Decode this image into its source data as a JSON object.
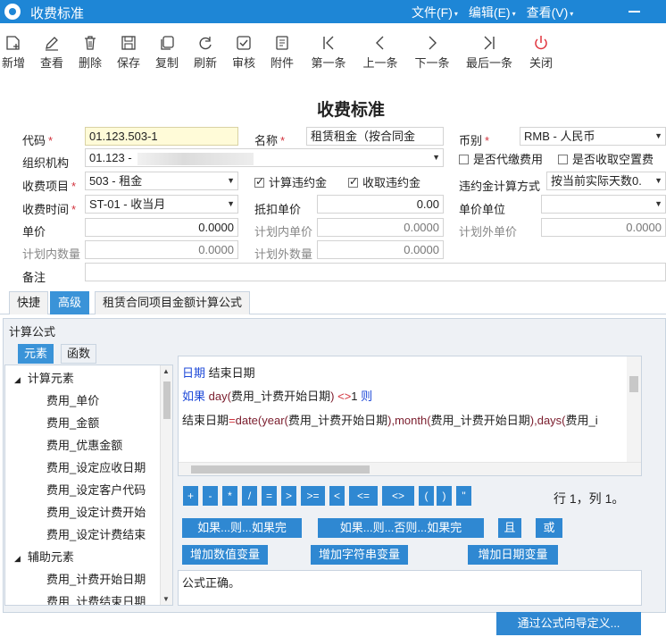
{
  "window": {
    "title": "收费标准",
    "menus": [
      "文件(F)",
      "编辑(E)",
      "查看(V)"
    ]
  },
  "toolbar": [
    {
      "label": "新增",
      "icon": "add-doc-icon"
    },
    {
      "label": "查看",
      "icon": "edit-pencil-icon"
    },
    {
      "label": "删除",
      "icon": "trash-icon"
    },
    {
      "label": "保存",
      "icon": "save-disk-icon"
    },
    {
      "label": "复制",
      "icon": "copy-icon"
    },
    {
      "label": "刷新",
      "icon": "refresh-icon"
    },
    {
      "label": "审核",
      "icon": "approve-check-icon"
    },
    {
      "label": "附件",
      "icon": "attachment-doc-icon"
    },
    {
      "label": "第一条",
      "icon": "first-record-icon"
    },
    {
      "label": "上一条",
      "icon": "prev-record-icon"
    },
    {
      "label": "下一条",
      "icon": "next-record-icon"
    },
    {
      "label": "最后一条",
      "icon": "last-record-icon"
    },
    {
      "label": "关闭",
      "icon": "power-close-icon"
    }
  ],
  "form": {
    "title": "收费标准",
    "code_label": "代码",
    "code_value": "01.123.503-1",
    "name_label": "名称",
    "name_value": "租赁租金（按合同金",
    "currency_label": "币别",
    "currency_value": "RMB - 人民币",
    "org_label": "组织机构",
    "org_value": "01.123 -",
    "substitute_label": "是否代缴费用",
    "vacant_label": "是否收取空置费",
    "fee_item_label": "收费项目",
    "fee_item_value": "503 - 租金",
    "calc_penalty_label": "计算违约金",
    "collect_penalty_label": "收取违约金",
    "penalty_method_label": "违约金计算方式",
    "penalty_method_value": "按当前实际天数0.",
    "fee_time_label": "收费时间",
    "fee_time_value": "ST-01 - 收当月",
    "deduct_price_label": "抵扣单价",
    "deduct_price_value": "0.00",
    "price_unit_label": "单价单位",
    "price_unit_value": "",
    "unit_price_label": "单价",
    "unit_price_value": "0.0000",
    "plan_in_price_label": "计划内单价",
    "plan_in_price_value": "0.0000",
    "plan_out_price_label": "计划外单价",
    "plan_out_price_value": "0.0000",
    "plan_in_qty_label": "计划内数量",
    "plan_in_qty_value": "0.0000",
    "plan_out_qty_label": "计划外数量",
    "plan_out_qty_value": "0.0000",
    "remark_label": "备注",
    "remark_value": "",
    "required_mark": "*"
  },
  "checks": {
    "substitute": false,
    "vacant": false,
    "calc_penalty": true,
    "collect_penalty": true
  },
  "tabs": [
    "快捷",
    "高级",
    "租赁合同项目金额计算公式"
  ],
  "active_tab": "高级",
  "formula": {
    "panel_title": "计算公式",
    "inner_tabs": [
      "元素",
      "函数"
    ],
    "tree": [
      {
        "type": "group",
        "label": "计算元素"
      },
      {
        "type": "leaf",
        "label": "费用_单价"
      },
      {
        "type": "leaf",
        "label": "费用_金额"
      },
      {
        "type": "leaf",
        "label": "费用_优惠金额"
      },
      {
        "type": "leaf",
        "label": "费用_设定应收日期"
      },
      {
        "type": "leaf",
        "label": "费用_设定客户代码"
      },
      {
        "type": "leaf",
        "label": "费用_设定计费开始"
      },
      {
        "type": "leaf",
        "label": "费用_设定计费结束"
      },
      {
        "type": "group",
        "label": "辅助元素"
      },
      {
        "type": "leaf",
        "label": "费用_计费开始日期"
      },
      {
        "type": "leaf",
        "label": "费用_计费结束日期"
      }
    ],
    "code": {
      "l1_kw": "日期",
      "l1_rest": " 结束日期",
      "l2_kw1": "如果",
      "l2_fn": " day(",
      "l2_arg": "费用_计费开始日期",
      "l2_close": ")",
      "l2_op": " <>",
      "l2_num": "1 ",
      "l2_kw2": "则",
      "l3_var": "结束日期",
      "l3_op": "=",
      "l3_f1": "date(",
      "l3_f2": "year(",
      "l3_a1": "费用_计费开始日期",
      "l3_c1": "),",
      "l3_f3": "month(",
      "l3_a2": "费用_计费开始日期",
      "l3_c2": "),",
      "l3_f4": "days(",
      "l3_a3": "费用_i"
    },
    "operators": [
      "+",
      "-",
      "*",
      "/",
      "=",
      ">",
      ">=",
      "<",
      "<=",
      "<>",
      "(",
      ")",
      "\""
    ],
    "position": "行 1，列 1。",
    "btn_if_end": "如果...则...如果完",
    "btn_if_else_end": "如果...则...否则...如果完",
    "btn_and": "且",
    "btn_or": "或",
    "btn_num_var": "增加数值变量",
    "btn_str_var": "增加字符串变量",
    "btn_date_var": "增加日期变量",
    "status_text": "公式正确。",
    "wizard_btn": "通过公式向导定义..."
  }
}
